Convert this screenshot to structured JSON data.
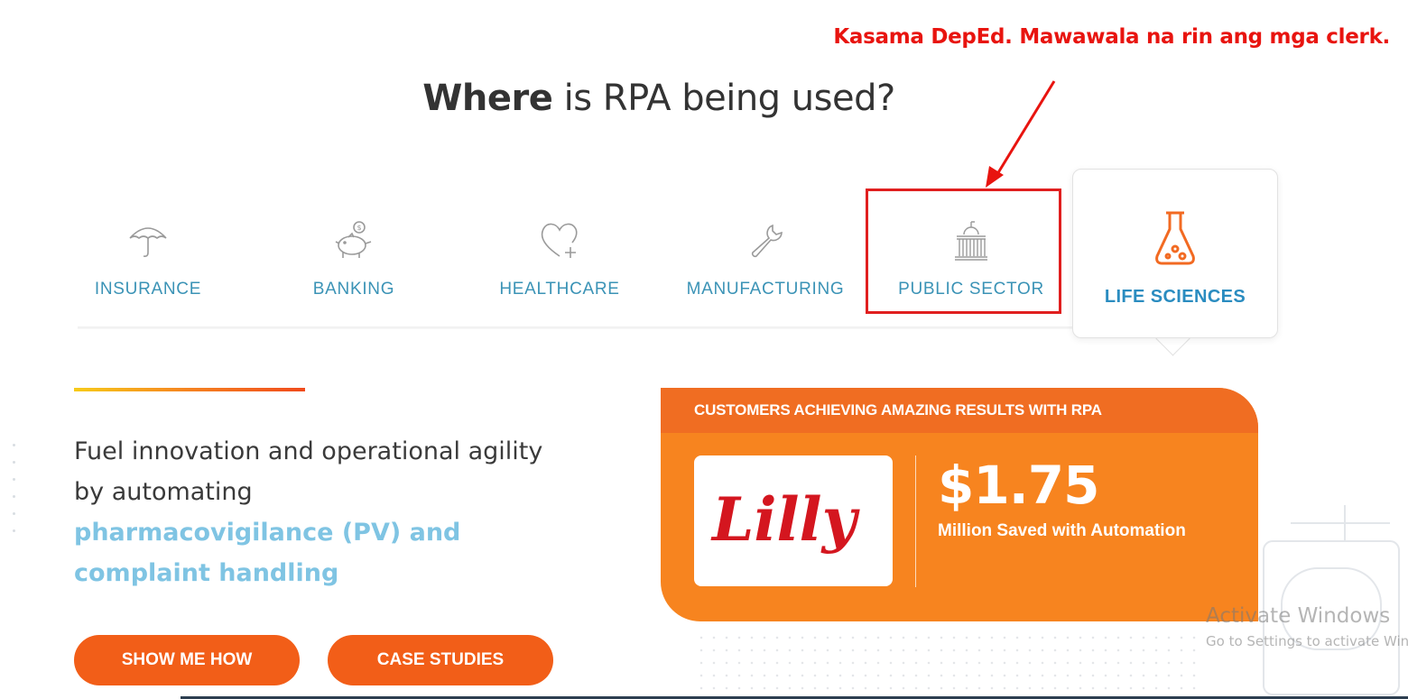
{
  "title": {
    "bold": "Where",
    "rest": " is RPA being used?"
  },
  "annotation": {
    "text": "Kasama DepEd. Mawawala na rin ang mga clerk.",
    "color": "#e8140f"
  },
  "tabs": [
    {
      "label": "INSURANCE",
      "icon": "umbrella-icon"
    },
    {
      "label": "BANKING",
      "icon": "piggy-bank-icon"
    },
    {
      "label": "HEALTHCARE",
      "icon": "heart-plus-icon"
    },
    {
      "label": "MANUFACTURING",
      "icon": "wrench-icon"
    },
    {
      "label": "PUBLIC SECTOR",
      "icon": "government-building-icon"
    }
  ],
  "active_tab": {
    "label": "LIFE SCIENCES",
    "icon": "flask-icon"
  },
  "description": {
    "line1": "Fuel innovation and operational agility by automating",
    "highlight1": "pharmacovigilance (PV) and",
    "highlight2": "complaint handling"
  },
  "buttons": {
    "show_me_how": "SHOW ME HOW",
    "case_studies": "CASE STUDIES"
  },
  "result_card": {
    "header": "CUSTOMERS ACHIEVING AMAZING RESULTS WITH RPA",
    "logo_text": "Lilly",
    "stat_value": "$1.75",
    "stat_caption": "Million Saved with Automation"
  },
  "watermark": {
    "title": "Activate Windows",
    "subtitle": "Go to Settings to activate Windows."
  },
  "colors": {
    "accent_orange": "#f25e18",
    "tab_blue": "#3b93b6",
    "highlight_blue": "#7fc4e3"
  }
}
